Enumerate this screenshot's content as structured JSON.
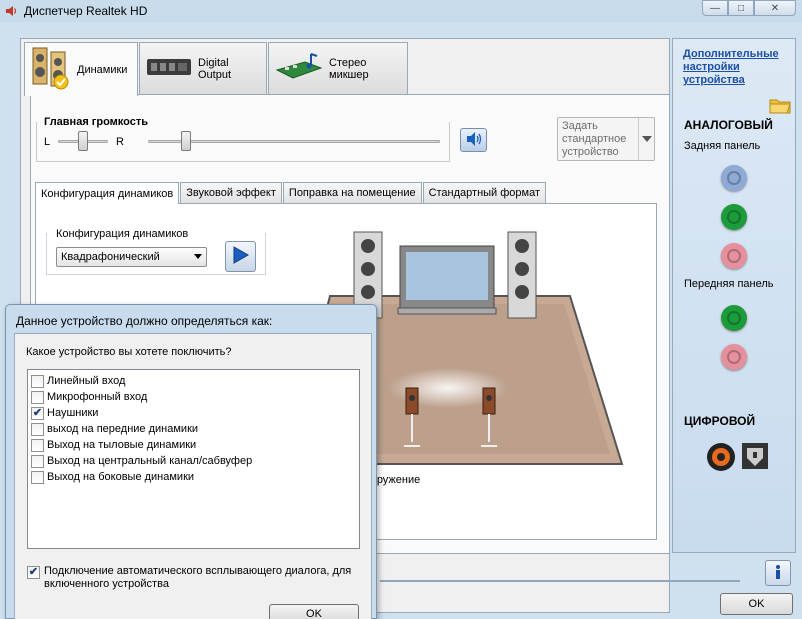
{
  "window": {
    "title": "Диспетчер Realtek HD"
  },
  "device_tabs": [
    {
      "label": "Динамики",
      "icon": "speaker-icon",
      "active": true
    },
    {
      "label": "Digital Output",
      "icon": "digital-output-icon",
      "active": false
    },
    {
      "label": "Стерео микшер",
      "icon": "stereo-mixer-icon",
      "active": false
    }
  ],
  "volume": {
    "label": "Главная громкость",
    "left_label": "L",
    "right_label": "R",
    "balance_pct": 50,
    "level_pct": 13
  },
  "default_device_button": "Задать стандартное устройство",
  "inner_tabs": [
    {
      "label": "Конфигурация динамиков",
      "active": true
    },
    {
      "label": "Звуковой эффект",
      "active": false
    },
    {
      "label": "Поправка на помещение",
      "active": false
    },
    {
      "label": "Стандартный формат",
      "active": false
    }
  ],
  "speaker_config": {
    "group_label": "Конфигурация динамиков",
    "selected": "Квадрафонический"
  },
  "surround_label": "кружение",
  "right_panel": {
    "advanced_link": "Дополнительные настройки устройства",
    "analog_title": "АНАЛОГОВЫЙ",
    "rear_label": "Задняя панель",
    "front_label": "Передняя панель",
    "digital_title": "ЦИФРОВОЙ",
    "jack_colors": {
      "blue": "#8eaad6",
      "green": "#1c9b3a",
      "pink": "#e6909e"
    }
  },
  "ok_button": "OK",
  "dialog": {
    "title": "Данное устройство должно определяться как:",
    "question": "Какое устройство вы хотете поключить?",
    "options": [
      {
        "label": "Линейный вход",
        "checked": false
      },
      {
        "label": "Микрофонный вход",
        "checked": false
      },
      {
        "label": "Наушники",
        "checked": true
      },
      {
        "label": "выход на передние динамики",
        "checked": false
      },
      {
        "label": "Выход на тыловые динамики",
        "checked": false
      },
      {
        "label": "Выход на центральный канал/сабвуфер",
        "checked": false
      },
      {
        "label": "Выход на боковые динамики",
        "checked": false
      }
    ],
    "auto_popup": {
      "label": "Подключение автоматического всплывающего диалога, для включенного устройства",
      "checked": true
    },
    "ok": "OK"
  }
}
